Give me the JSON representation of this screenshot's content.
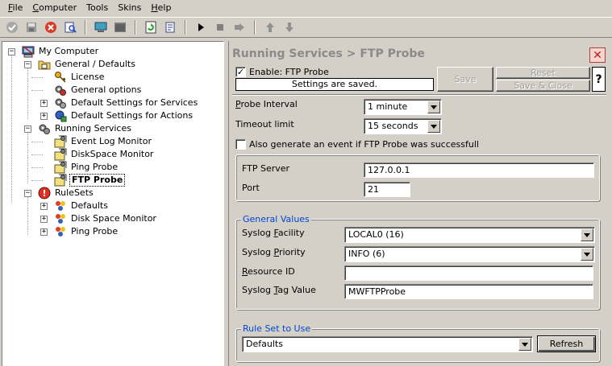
{
  "menu": [
    {
      "label": "File",
      "ul": "F",
      "rest": "ile"
    },
    {
      "label": "Computer",
      "ul": "C",
      "rest": "omputer"
    },
    {
      "label": "Tools",
      "ul": "",
      "rest": "Tools"
    },
    {
      "label": "Skins",
      "ul": "",
      "rest": "Skins"
    },
    {
      "label": "Help",
      "ul": "H",
      "rest": "elp"
    }
  ],
  "tree": {
    "root": "My Computer",
    "general": "General / Defaults",
    "license": "License",
    "general_options": "General options",
    "default_services": "Default Settings for Services",
    "default_actions": "Default Settings for Actions",
    "running_services": "Running Services",
    "event_log": "Event Log Monitor",
    "diskspace": "DiskSpace Monitor",
    "ping": "Ping Probe",
    "ftp": "FTP Probe",
    "rulesets": "RuleSets",
    "rs_defaults": "Defaults",
    "rs_disk": "Disk Space Monitor",
    "rs_ping": "Ping Probe"
  },
  "panel": {
    "title": "Running Services > FTP Probe",
    "enable_label": "Enable: FTP Probe",
    "enabled": true,
    "status": "Settings are saved.",
    "save": "Save",
    "reset": "Reset",
    "save_close": "Save & Close",
    "help": "?",
    "probe_interval_label_u": "P",
    "probe_interval_label_rest": "robe Interval",
    "probe_interval_value": "1 minute",
    "timeout_label": "Timeout limit",
    "timeout_value": "15 seconds",
    "also_generate": "Also generate an event if FTP Probe was successfull",
    "also_generate_checked": false,
    "ftp_server_label": "FTP Server",
    "ftp_server_value": "127.0.0.1",
    "port_label": "Port",
    "port_value": "21",
    "general_values_title": "General Values",
    "syslog_facility_label_pre": "Syslog ",
    "syslog_facility_label_u": "F",
    "syslog_facility_label_rest": "acility",
    "syslog_facility_value": "LOCAL0 (16)",
    "syslog_priority_label_pre": "Syslog ",
    "syslog_priority_label_u": "P",
    "syslog_priority_label_rest": "riority",
    "syslog_priority_value": "INFO (6)",
    "resource_id_label_u": "R",
    "resource_id_label_rest": "esource ID",
    "resource_id_value": "",
    "syslog_tag_label_pre": "Syslog ",
    "syslog_tag_label_u": "T",
    "syslog_tag_label_rest": "ag Value",
    "syslog_tag_value": "MWFTPProbe",
    "rule_set_title": "Rule Set to Use",
    "rule_set_value": "Defaults",
    "refresh": "Refresh"
  },
  "colors": {
    "accent_blue": "#0046d5",
    "window_bg": "#d4d0c8",
    "close_red": "#b02020"
  }
}
